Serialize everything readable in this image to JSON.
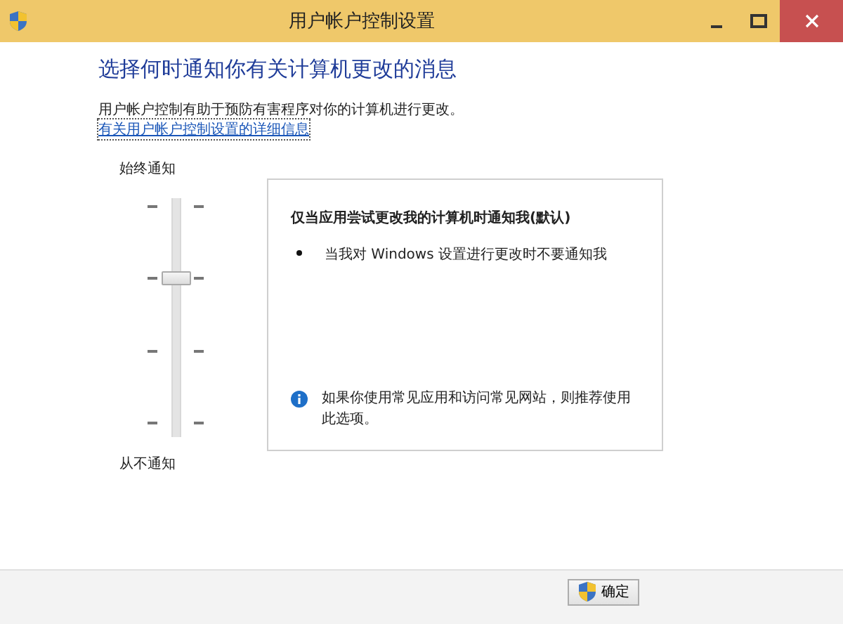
{
  "window": {
    "title": "用户帐户控制设置"
  },
  "heading": "选择何时通知你有关计算机更改的消息",
  "description": "用户帐户控制有助于预防有害程序对你的计算机进行更改。",
  "link": "有关用户帐户控制设置的详细信息",
  "slider": {
    "top_label": "始终通知",
    "bottom_label": "从不通知",
    "level": 0.67
  },
  "panel": {
    "title": "仅当应用尝试更改我的计算机时通知我(默认)",
    "bullets": [
      "当我对 Windows 设置进行更改时不要通知我"
    ],
    "note": "如果你使用常见应用和访问常见网站，则推荐使用此选项。"
  },
  "buttons": [
    {
      "label": "确定",
      "kind": "shield"
    }
  ]
}
